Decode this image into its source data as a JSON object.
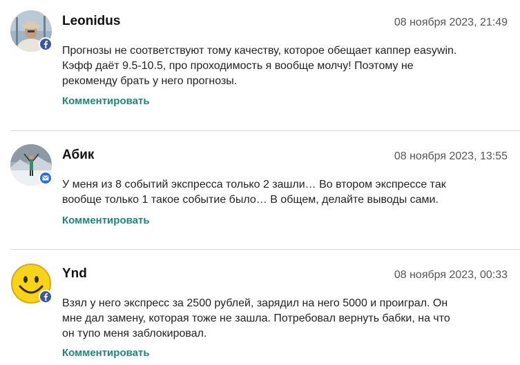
{
  "comments": [
    {
      "author": "Leonidus",
      "date": "08 ноября 2023, 21:49",
      "text": "Прогнозы не соответствуют тому качеству, которое обещает каппер easywin. Кэфф даёт 9.5-10.5, про проходимость я вообще молчу! Поэтому не рекоменду брать у него прогнозы.",
      "reply_label": "Комментировать",
      "badge_icon": "facebook-icon",
      "avatar_icon": "user-avatar-man-in-hat"
    },
    {
      "author": "Абик",
      "date": "08 ноября 2023, 13:55",
      "text": "У меня из 8 событий экспресса только 2 зашли… Во втором экспрессе так вообще только 1 такое событие было… В общем, делайте выводы сами.",
      "reply_label": "Комментировать",
      "badge_icon": "mail-icon",
      "avatar_icon": "user-avatar-mountain-skier"
    },
    {
      "author": "Ynd",
      "date": "08 ноября 2023, 00:33",
      "text": "Взял у него экспресс за 2500 рублей, зарядил на него 5000 и проиграл. Он мне дал замену, которая тоже не зашла. Потребовал вернуть бабки, на что он тупо меня заблокировал.",
      "reply_label": "Комментировать",
      "badge_icon": "facebook-icon",
      "avatar_icon": "user-avatar-smiley"
    }
  ],
  "colors": {
    "reply_link": "#1f8577",
    "facebook_badge": "#3b5998",
    "mail_badge": "#2a6fd6",
    "divider": "#d9d9d9"
  }
}
